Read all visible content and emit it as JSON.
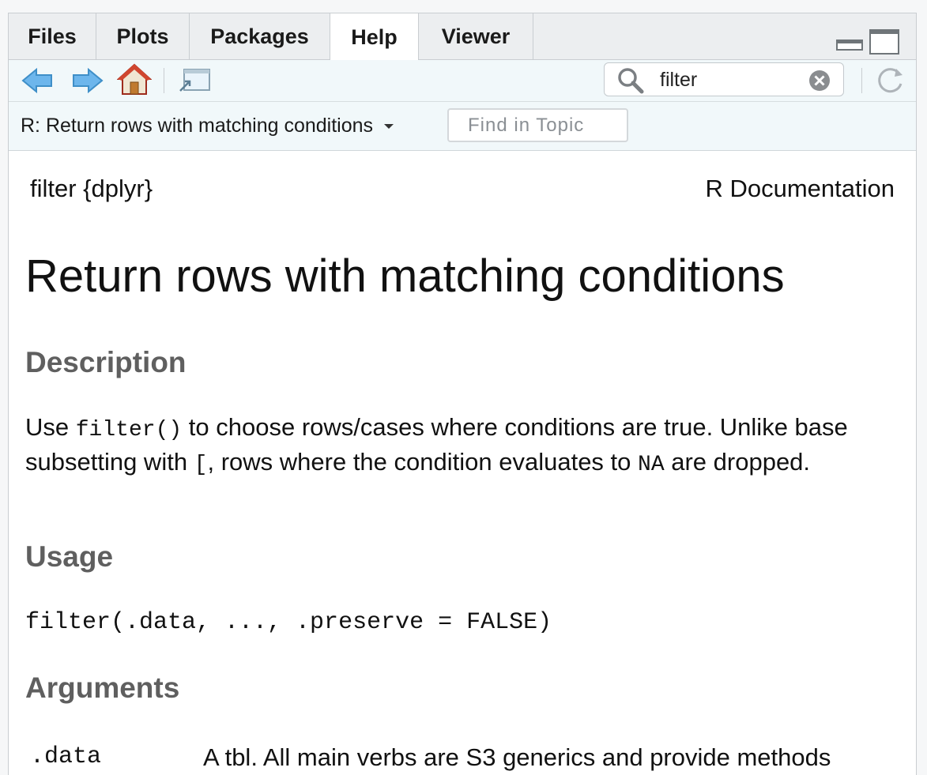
{
  "tabs": [
    {
      "label": "Files",
      "active": false
    },
    {
      "label": "Plots",
      "active": false
    },
    {
      "label": "Packages",
      "active": false
    },
    {
      "label": "Help",
      "active": true
    },
    {
      "label": "Viewer",
      "active": false
    }
  ],
  "toolbar": {
    "icons": [
      "back-arrow-icon",
      "forward-arrow-icon",
      "home-icon",
      "popout-window-icon",
      "refresh-icon"
    ],
    "search": {
      "value": "filter",
      "icons": [
        "search-icon",
        "clear-icon"
      ]
    }
  },
  "topic_bar": {
    "topic_label": "R: Return rows with matching conditions",
    "find_placeholder": "Find in Topic"
  },
  "doc": {
    "name": "filter {dplyr}",
    "source": "R Documentation",
    "title": "Return rows with matching conditions",
    "description_heading": "Description",
    "description": {
      "p1": "Use ",
      "code1": "filter()",
      "p2": " to choose rows/cases where conditions are true. Unlike base subsetting with ",
      "code2": "[",
      "p3": ", rows where the condition evaluates to ",
      "code3": "NA",
      "p4": " are dropped."
    },
    "usage_heading": "Usage",
    "usage": "filter(.data, ..., .preserve = FALSE)",
    "arguments_heading": "Arguments",
    "argument": {
      "name": ".data",
      "description": "A tbl. All main verbs are S3 generics and provide methods"
    }
  },
  "colors": {
    "tab_bar_bg": "#eceef0",
    "toolbar_bg": "#f1f8fa",
    "heading_grey": "#5f5f5f",
    "arrow_blue": "#5aa9e0",
    "home_red": "#c8412d"
  }
}
